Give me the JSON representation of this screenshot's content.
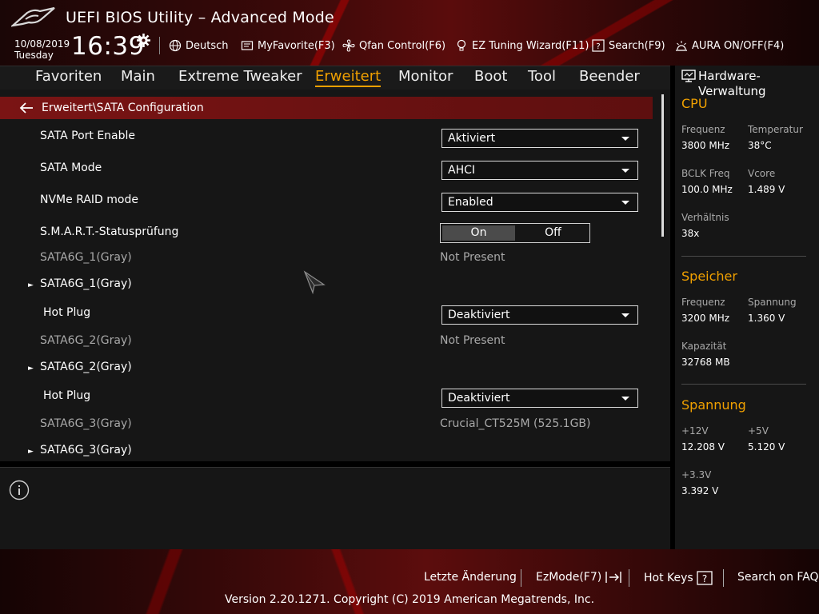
{
  "header": {
    "title": "UEFI BIOS Utility – Advanced Mode",
    "date": "10/08/2019",
    "day": "Tuesday",
    "time": "16:39",
    "buttons": {
      "language": "Deutsch",
      "myfavorite": "MyFavorite(F3)",
      "qfan": "Qfan Control(F6)",
      "ez_tuning": "EZ Tuning Wizard(F11)",
      "search": "Search(F9)",
      "aura": "AURA ON/OFF(F4)"
    }
  },
  "nav": {
    "tabs": [
      "Favoriten",
      "Main",
      "Extreme Tweaker",
      "Erweitert",
      "Monitor",
      "Boot",
      "Tool",
      "Beender"
    ],
    "active": "Erweitert"
  },
  "breadcrumb": "Erweitert\\SATA Configuration",
  "settings": {
    "sata_port_enable": {
      "label": "SATA Port Enable",
      "value": "Aktiviert"
    },
    "sata_mode": {
      "label": "SATA Mode",
      "value": "AHCI"
    },
    "nvme_raid": {
      "label": "NVMe RAID mode",
      "value": "Enabled"
    },
    "smart": {
      "label": "S.M.A.R.T.-Statusprüfung",
      "on": "On",
      "off": "Off",
      "selected": "On"
    },
    "port1_info": {
      "label": "SATA6G_1(Gray)",
      "value": "Not Present"
    },
    "port1_sub": {
      "label": "SATA6G_1(Gray)"
    },
    "hotplug1": {
      "label": "Hot Plug",
      "value": "Deaktiviert"
    },
    "port2_info": {
      "label": "SATA6G_2(Gray)",
      "value": "Not Present"
    },
    "port2_sub": {
      "label": "SATA6G_2(Gray)"
    },
    "hotplug2": {
      "label": "Hot Plug",
      "value": "Deaktiviert"
    },
    "port3_info": {
      "label": "SATA6G_3(Gray)",
      "value": "Crucial_CT525M (525.1GB)"
    },
    "port3_sub": {
      "label": "SATA6G_3(Gray)"
    }
  },
  "hardware": {
    "title": "Hardware-Verwaltung",
    "cpu": {
      "heading": "CPU",
      "freq_label": "Frequenz",
      "freq": "3800 MHz",
      "temp_label": "Temperatur",
      "temp": "38°C",
      "bclk_label": "BCLK Freq",
      "bclk": "100.0 MHz",
      "vcore_label": "Vcore",
      "vcore": "1.489 V",
      "ratio_label": "Verhältnis",
      "ratio": "38x"
    },
    "memory": {
      "heading": "Speicher",
      "freq_label": "Frequenz",
      "freq": "3200 MHz",
      "volt_label": "Spannung",
      "volt": "1.360 V",
      "cap_label": "Kapazität",
      "cap": "32768 MB"
    },
    "voltage": {
      "heading": "Spannung",
      "v12_label": "+12V",
      "v12": "12.208 V",
      "v5_label": "+5V",
      "v5": "5.120 V",
      "v33_label": "+3.3V",
      "v33": "3.392 V"
    }
  },
  "footer": {
    "last_change": "Letzte Änderung",
    "ezmode": "EzMode(F7)",
    "hotkeys": "Hot Keys",
    "faq": "Search on FAQ",
    "copyright": "Version 2.20.1271. Copyright (C) 2019 American Megatrends, Inc."
  },
  "colors": {
    "accent": "#f0a000",
    "brand_red": "#7a1414",
    "panel": "#161616"
  },
  "icons": [
    "rog-logo",
    "gear-icon",
    "globe-icon",
    "favorite-icon",
    "fan-icon",
    "bulb-icon",
    "search-icon",
    "aura-icon",
    "back-arrow-icon",
    "info-icon",
    "monitor-icon",
    "ezmode-icon",
    "question-icon",
    "mouse-pointer-icon"
  ]
}
